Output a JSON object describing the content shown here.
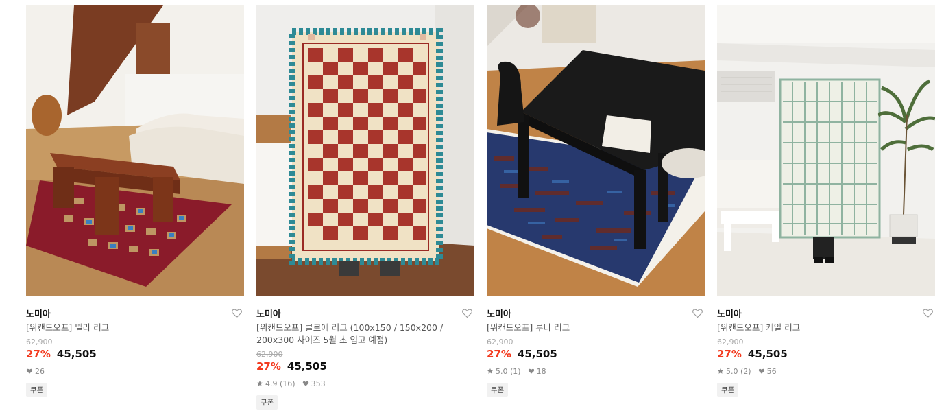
{
  "products": [
    {
      "brand": "노미아",
      "name": "[위캔드오프] 넬라 러그",
      "original_price": "62,900",
      "discount": "27%",
      "price": "45,505",
      "likes": "26",
      "badge": "쿠폰",
      "image_icon": "rug-living-room-photo"
    },
    {
      "brand": "노미아",
      "name": "[위캔드오프] 클로에 러그 (100x150 / 150x200 / 200x300 사이즈 5월 초 입고 예정)",
      "original_price": "62,900",
      "discount": "27%",
      "price": "45,505",
      "rating": "4.9",
      "reviews": "(16)",
      "likes": "353",
      "badge": "쿠폰",
      "image_icon": "rug-held-up-photo"
    },
    {
      "brand": "노미아",
      "name": "[위캔드오프] 루나 러그",
      "original_price": "62,900",
      "discount": "27%",
      "price": "45,505",
      "rating": "5.0",
      "reviews": "(1)",
      "likes": "18",
      "badge": "쿠폰",
      "image_icon": "rug-dining-table-photo"
    },
    {
      "brand": "노미아",
      "name": "[위캔드오프] 케일 러그",
      "original_price": "62,900",
      "discount": "27%",
      "price": "45,505",
      "rating": "5.0",
      "reviews": "(2)",
      "likes": "56",
      "badge": "쿠폰",
      "image_icon": "rug-grid-held-photo"
    }
  ],
  "colors": {
    "discount": "#f33a1e",
    "strike": "#aaaaaa",
    "badge_bg": "#f1f1f1"
  }
}
